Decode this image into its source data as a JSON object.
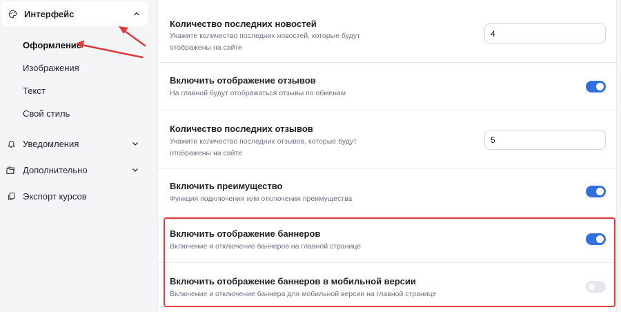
{
  "sidebar": {
    "groups": [
      {
        "label": "Интерфейс",
        "icon": "palette-icon",
        "expanded": true
      },
      {
        "label": "Уведомления",
        "icon": "bell-icon",
        "expanded": false
      },
      {
        "label": "Дополнительно",
        "icon": "folders-icon",
        "expanded": false
      },
      {
        "label": "Экспорт курсов",
        "icon": "copy-icon"
      }
    ],
    "sub_items": [
      {
        "label": "Оформление",
        "active": true
      },
      {
        "label": "Изображения"
      },
      {
        "label": "Текст"
      },
      {
        "label": "Свой стиль"
      }
    ]
  },
  "settings": [
    {
      "title": "Количество последних новостей",
      "description": "Укажите количество последних новостей, которые будут отображены на сайте",
      "control": "input",
      "value": "4"
    },
    {
      "title": "Включить отображение отзывов",
      "description": "На главной будут отображаться отзывы по обменам",
      "control": "toggle",
      "on": true
    },
    {
      "title": "Количество последних отзывов",
      "description": "Укажите количество последних отзывов, которые будут отображены на сайте",
      "control": "input",
      "value": "5"
    },
    {
      "title": "Включить преимущество",
      "description": "Функция подключения или отключения преимущества",
      "control": "toggle",
      "on": true
    },
    {
      "title": "Включить отображение баннеров",
      "description": "Включение и отключение баннеров на главной странице",
      "control": "toggle",
      "on": true
    },
    {
      "title": "Включить отображение баннеров в мобильной версии",
      "description": "Включение и отключение баннера для мобильной версии на главной странице",
      "control": "toggle",
      "on": false
    }
  ],
  "colors": {
    "accent": "#2f6fe0",
    "annotation": "#e0393a"
  }
}
